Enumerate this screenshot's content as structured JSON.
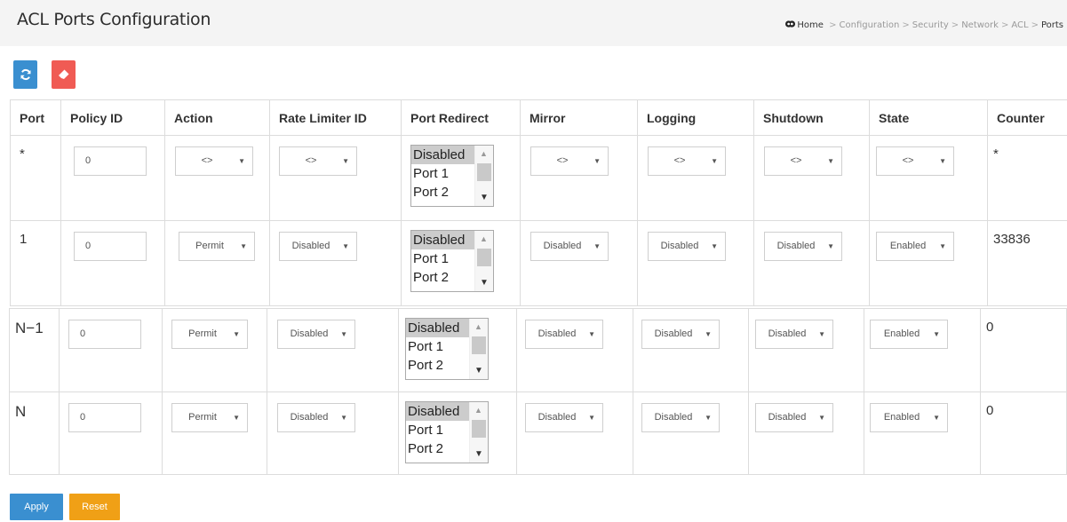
{
  "page": {
    "title": "ACL Ports Configuration",
    "breadcrumb": [
      "Home",
      "Configuration",
      "Security",
      "Network",
      "ACL",
      "Ports"
    ]
  },
  "toolbar": {
    "refresh_icon": "refresh-icon",
    "clear_icon": "eraser-icon",
    "refresh_color": "#3a8fd0",
    "clear_color": "#f05b54"
  },
  "columns": [
    "Port",
    "Policy ID",
    "Action",
    "Rate Limiter ID",
    "Port Redirect",
    "Mirror",
    "Logging",
    "Shutdown",
    "State",
    "Counter"
  ],
  "rows": [
    {
      "port": "*",
      "policy_id": "0",
      "action": "<>",
      "rate_limiter": "<>",
      "redirect": [
        "Disabled",
        "Port 1",
        "Port 2"
      ],
      "mirror": "<>",
      "logging": "<>",
      "shutdown": "<>",
      "state": "<>",
      "counter": "*"
    },
    {
      "port": "1",
      "policy_id": "0",
      "action": "Permit",
      "rate_limiter": "Disabled",
      "redirect": [
        "Disabled",
        "Port 1",
        "Port 2"
      ],
      "mirror": "Disabled",
      "logging": "Disabled",
      "shutdown": "Disabled",
      "state": "Enabled",
      "counter": "33836"
    },
    {
      "port": "N−1",
      "policy_id": "0",
      "action": "Permit",
      "rate_limiter": "Disabled",
      "redirect": [
        "Disabled",
        "Port 1",
        "Port 2"
      ],
      "mirror": "Disabled",
      "logging": "Disabled",
      "shutdown": "Disabled",
      "state": "Enabled",
      "counter": "0"
    },
    {
      "port": "N",
      "policy_id": "0",
      "action": "Permit",
      "rate_limiter": "Disabled",
      "redirect": [
        "Disabled",
        "Port 1",
        "Port 2"
      ],
      "mirror": "Disabled",
      "logging": "Disabled",
      "shutdown": "Disabled",
      "state": "Enabled",
      "counter": "0"
    }
  ],
  "buttons": {
    "apply": "Apply",
    "reset": "Reset",
    "apply_color": "#3a8fd0",
    "reset_color": "#f0a016"
  }
}
